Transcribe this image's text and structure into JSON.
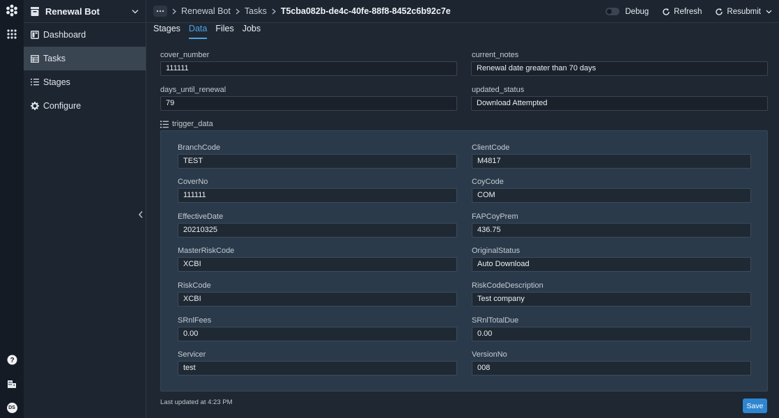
{
  "app": {
    "name": "Renewal Bot"
  },
  "sidebar": {
    "items": [
      {
        "label": "Dashboard",
        "icon": "dashboard-icon"
      },
      {
        "label": "Tasks",
        "icon": "table-icon"
      },
      {
        "label": "Stages",
        "icon": "numbered-list-icon"
      },
      {
        "label": "Configure",
        "icon": "gear-icon"
      }
    ]
  },
  "breadcrumb": {
    "app": "Renewal Bot",
    "section": "Tasks",
    "current": "T5cba082b-de4c-40fe-88f8-8452c6b92c7e"
  },
  "toolbar": {
    "debug_label": "Debug",
    "refresh_label": "Refresh",
    "resubmit_label": "Resubmit"
  },
  "tabs": [
    "Stages",
    "Data",
    "Files",
    "Jobs"
  ],
  "fields": {
    "cover_number": {
      "label": "cover_number",
      "value": "111111"
    },
    "current_notes": {
      "label": "current_notes",
      "value": "Renewal date greater than 70 days"
    },
    "days_until_renewal": {
      "label": "days_until_renewal",
      "value": "79"
    },
    "updated_status": {
      "label": "updated_status",
      "value": "Download Attempted"
    }
  },
  "trigger_data": {
    "label": "trigger_data",
    "left": [
      {
        "label": "BranchCode",
        "value": "TEST"
      },
      {
        "label": "CoverNo",
        "value": "111111"
      },
      {
        "label": "EffectiveDate",
        "value": "20210325"
      },
      {
        "label": "MasterRiskCode",
        "value": "XCBI"
      },
      {
        "label": "RiskCode",
        "value": "XCBI"
      },
      {
        "label": "SRnlFees",
        "value": "0.00"
      },
      {
        "label": "Servicer",
        "value": "test"
      }
    ],
    "right": [
      {
        "label": "ClientCode",
        "value": "M4817"
      },
      {
        "label": "CoyCode",
        "value": "COM"
      },
      {
        "label": "FAPCoyPrem",
        "value": "436.75"
      },
      {
        "label": "OriginalStatus",
        "value": "Auto Download"
      },
      {
        "label": "RiskCodeDescription",
        "value": "Test company"
      },
      {
        "label": "SRnlTotalDue",
        "value": "0.00"
      },
      {
        "label": "VersionNo",
        "value": "008"
      }
    ]
  },
  "footer": {
    "last_updated": "Last updated at 4:23 PM",
    "save_label": "Save"
  },
  "rail": {
    "user_initials": "DS"
  },
  "colors": {
    "accent": "#4ba3e3",
    "button": "#2f86d0",
    "background": "#1f2732",
    "panel": "#2b3a4a"
  }
}
